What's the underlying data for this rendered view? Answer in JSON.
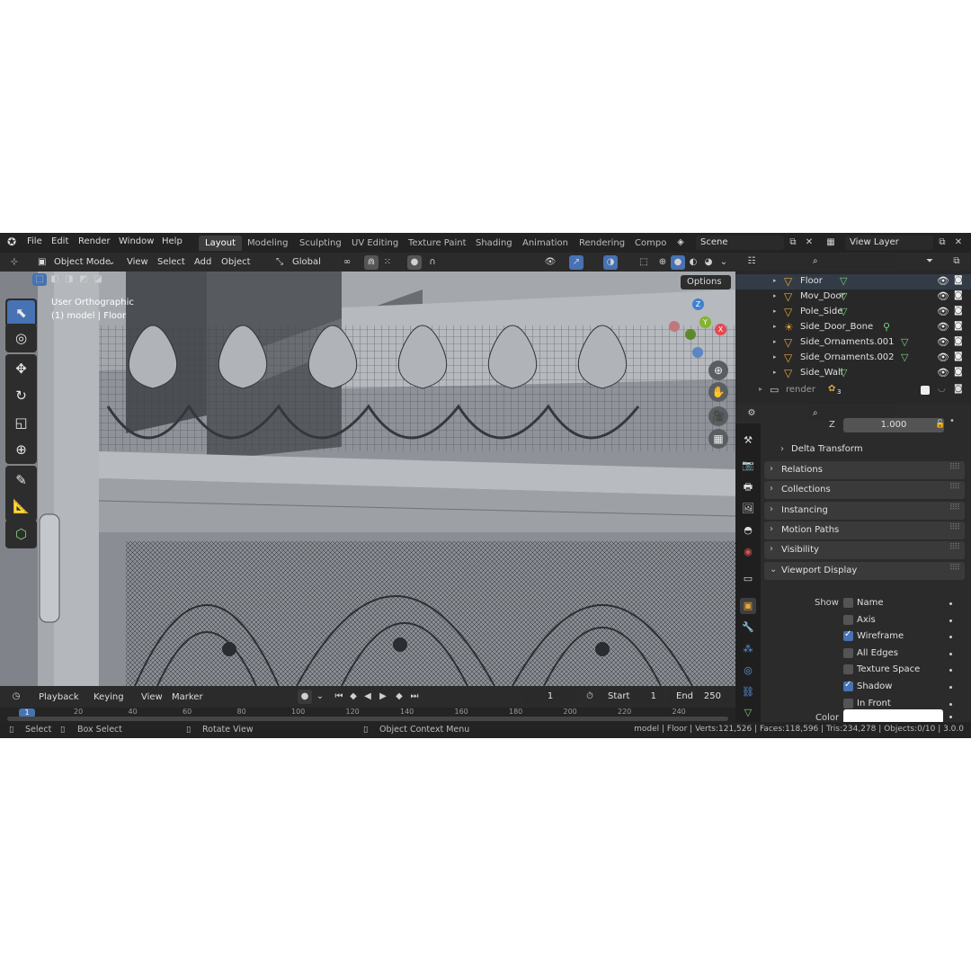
{
  "menubar": {
    "items": [
      "File",
      "Edit",
      "Render",
      "Window",
      "Help"
    ],
    "workspaces": [
      "Layout",
      "Modeling",
      "Sculpting",
      "UV Editing",
      "Texture Paint",
      "Shading",
      "Animation",
      "Rendering",
      "Compo"
    ],
    "active_workspace": "Layout",
    "scene": "Scene",
    "view_layer": "View Layer"
  },
  "viewport_header": {
    "mode": "Object Mode",
    "menus": [
      "View",
      "Select",
      "Add",
      "Object"
    ],
    "orientation": "Global",
    "options_label": "Options"
  },
  "viewport": {
    "view_name": "User Orthographic",
    "object_info": "(1) model | Floor",
    "gizmo_axes": [
      "Z",
      "Y",
      "X"
    ],
    "colors": {
      "x": "#e5474f",
      "y": "#84b42d",
      "z": "#3f80d0",
      "active": "#4772b3"
    }
  },
  "outliner": {
    "rows": [
      {
        "label": "Floor",
        "icon": "mesh-object-icon"
      },
      {
        "label": "Mov_Door",
        "icon": "mesh-object-icon"
      },
      {
        "label": "Pole_Side",
        "icon": "mesh-object-icon"
      },
      {
        "label": "Side_Door_Bone",
        "icon": "armature-object-icon"
      },
      {
        "label": "Side_Ornaments.001",
        "icon": "mesh-object-icon"
      },
      {
        "label": "Side_Ornaments.002",
        "icon": "mesh-object-icon"
      },
      {
        "label": "Side_Wall",
        "icon": "mesh-object-icon"
      }
    ],
    "collection": {
      "label": "render",
      "badge": "3"
    }
  },
  "properties": {
    "z_label": "Z",
    "z_value": "1.000",
    "delta_transform": "Delta Transform",
    "panels": [
      "Relations",
      "Collections",
      "Instancing",
      "Motion Paths",
      "Visibility",
      "Viewport Display"
    ],
    "show_label": "Show",
    "checkboxes": [
      {
        "label": "Name",
        "checked": false
      },
      {
        "label": "Axis",
        "checked": false
      },
      {
        "label": "Wireframe",
        "checked": true
      },
      {
        "label": "All Edges",
        "checked": false
      },
      {
        "label": "Texture Space",
        "checked": false
      },
      {
        "label": "Shadow",
        "checked": true
      },
      {
        "label": "In Front",
        "checked": false
      }
    ],
    "color_label": "Color"
  },
  "timeline": {
    "menus": [
      "Playback",
      "Keying",
      "View",
      "Marker"
    ],
    "current_frame": "1",
    "start_label": "Start",
    "start_value": "1",
    "end_label": "End",
    "end_value": "250",
    "scale_marks": [
      "20",
      "40",
      "60",
      "80",
      "100",
      "120",
      "140",
      "160",
      "180",
      "200",
      "220",
      "240"
    ],
    "playhead": "1"
  },
  "statusbar": {
    "select": "Select",
    "box_select": "Box Select",
    "rotate_view": "Rotate View",
    "context_menu": "Object Context Menu",
    "stats": "model | Floor | Verts:121,526 | Faces:118,596 | Tris:234,278 | Objects:0/10 | 3.0.0"
  }
}
